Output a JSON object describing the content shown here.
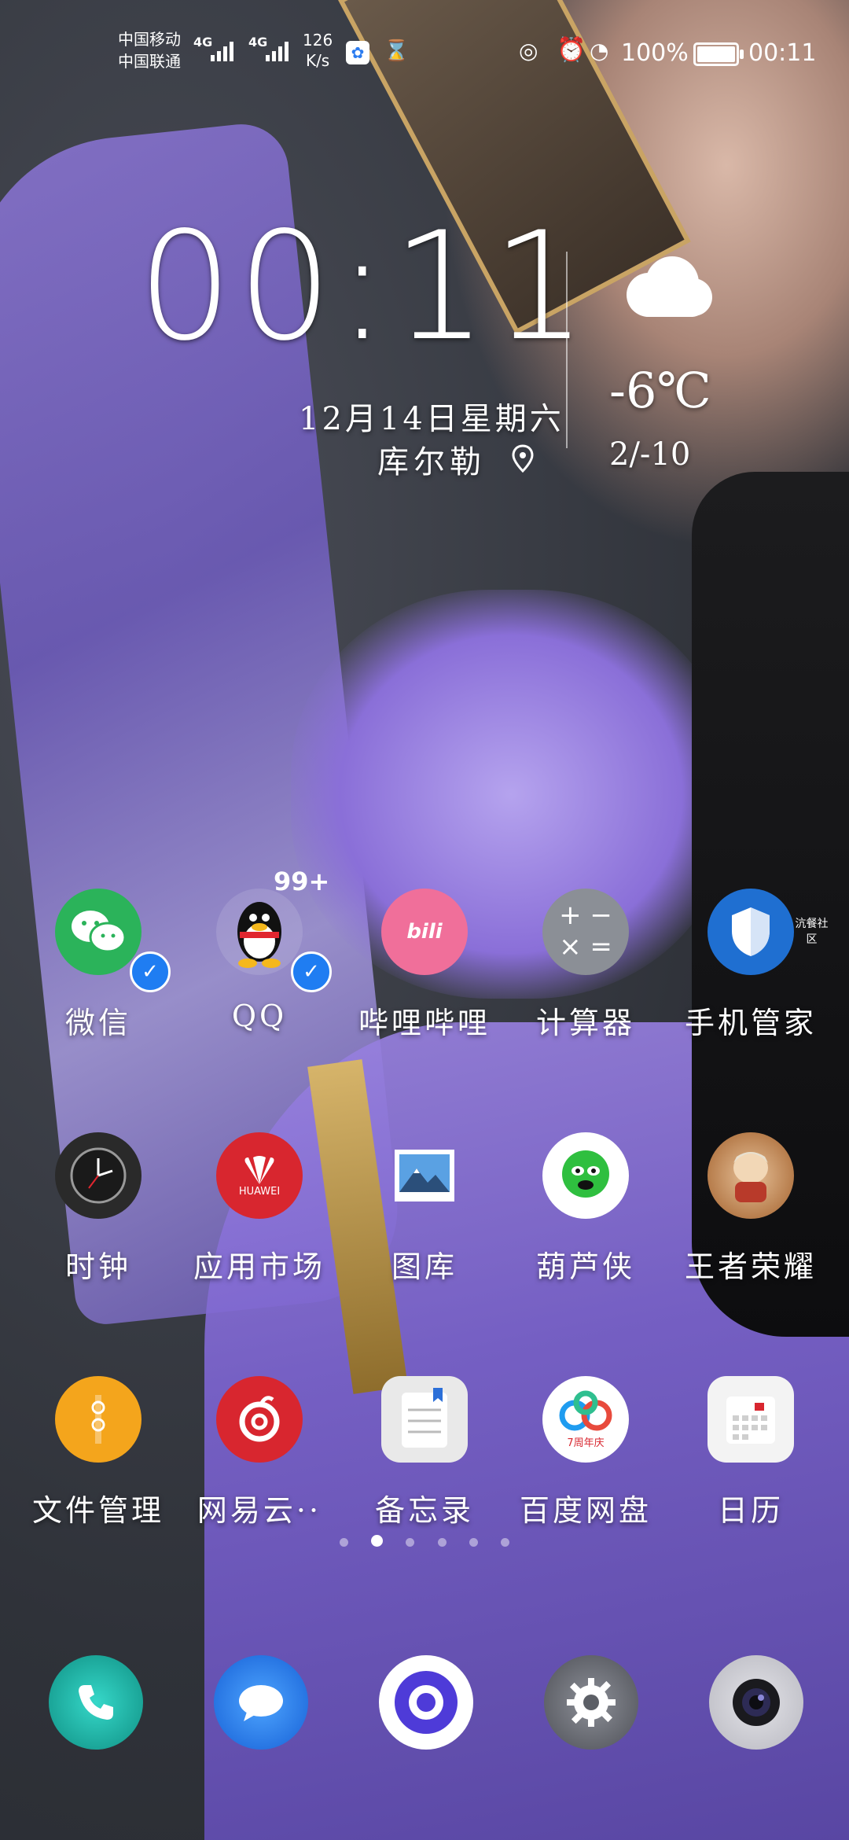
{
  "status_bar": {
    "carrier_1": "中国移动",
    "carrier_2": "中国联通",
    "network_1": "4G",
    "network_2": "4G",
    "speed_value": "126",
    "speed_unit": "K/s",
    "battery_percent": "100%",
    "time": "00:11"
  },
  "widget": {
    "clock": "00:11",
    "date": "12月14日星期六",
    "location": "库尔勒",
    "temperature": "-6℃",
    "range": "2/-10",
    "weather_icon": "cloud-icon"
  },
  "apps": {
    "row1": [
      {
        "label": "微信",
        "icon": "wechat-icon",
        "color": "#2bb35a"
      },
      {
        "label": "QQ",
        "icon": "qq-icon",
        "color": "#1a1a1a",
        "badge": "99+"
      },
      {
        "label": "哔哩哔哩",
        "icon": "bilibili-icon",
        "color": "#f06f9a"
      },
      {
        "label": "计算器",
        "icon": "calculator-icon",
        "color": "#8b8f96"
      },
      {
        "label": "手机管家",
        "icon": "shield-icon",
        "color": "#1f6fd1",
        "corner_text": "沆餐社区"
      }
    ],
    "row2": [
      {
        "label": "时钟",
        "icon": "clock-icon",
        "color": "#2a2a2a"
      },
      {
        "label": "应用市场",
        "icon": "huawei-appgallery-icon",
        "color": "#d8262f",
        "sub": "HUAWEI"
      },
      {
        "label": "图库",
        "icon": "gallery-icon",
        "color": "#4a90d9"
      },
      {
        "label": "葫芦侠",
        "icon": "huluxia-icon",
        "color": "#2fbf3f"
      },
      {
        "label": "王者荣耀",
        "icon": "honor-of-kings-icon",
        "color": "#c6863a"
      }
    ],
    "row3": [
      {
        "label": "文件管理",
        "icon": "files-icon",
        "color": "#f4a51c"
      },
      {
        "label": "网易云··",
        "icon": "netease-music-icon",
        "color": "#d8262f"
      },
      {
        "label": "备忘录",
        "icon": "notes-icon",
        "color": "#e9e9e9"
      },
      {
        "label": "百度网盘",
        "icon": "baidu-netdisk-icon",
        "color": "#ffffff",
        "sub": "7周年庆"
      },
      {
        "label": "日历",
        "icon": "calendar-icon",
        "color": "#f3f3f3"
      }
    ]
  },
  "page_indicator": {
    "count": 6,
    "active": 1
  },
  "dock": [
    {
      "name": "phone-icon",
      "color": "#1fb5a7"
    },
    {
      "name": "messages-icon",
      "color": "#1f7df2"
    },
    {
      "name": "browser-icon",
      "color": "#4e3bd8"
    },
    {
      "name": "settings-icon",
      "color": "#6b6e75"
    },
    {
      "name": "camera-icon",
      "color": "#2a2a2e"
    }
  ]
}
